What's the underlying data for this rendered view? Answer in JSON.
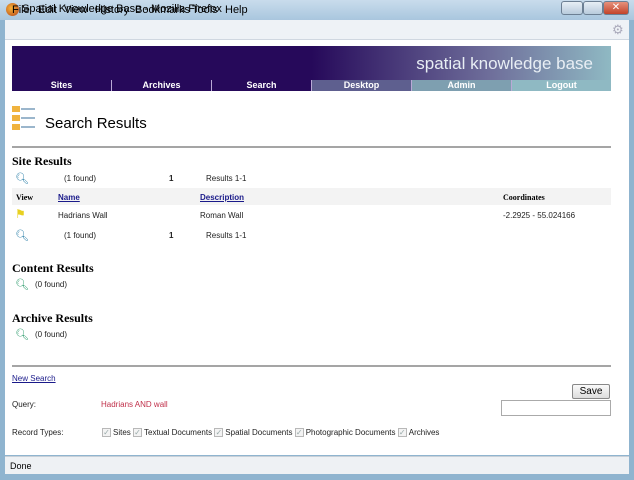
{
  "window": {
    "title": "Spatial Knowledge Base - Mozilla Firefox"
  },
  "menu": [
    "File",
    "Edit",
    "View",
    "History",
    "Bookmarks",
    "Tools",
    "Help"
  ],
  "banner": {
    "title": "spatial knowledge base"
  },
  "nav": [
    {
      "label": "Sites",
      "color": "#26095a"
    },
    {
      "label": "Archives",
      "color": "#26095a"
    },
    {
      "label": "Search",
      "color": "#26095a"
    },
    {
      "label": "Desktop",
      "color": "#5e5f8f"
    },
    {
      "label": "Admin",
      "color": "#7e9fb0"
    },
    {
      "label": "Logout",
      "color": "#8fb9c3"
    }
  ],
  "page_title": "Search Results",
  "site_results": {
    "heading": "Site Results",
    "found": "(1 found)",
    "page": "1",
    "range": "Results 1-1",
    "columns": {
      "view": "View",
      "name": "Name",
      "description": "Description",
      "coordinates": "Coordinates"
    },
    "rows": [
      {
        "name": "Hadrians Wall",
        "description": "Roman Wall",
        "coordinates": "-2.2925 - 55.024166"
      }
    ]
  },
  "content_results": {
    "heading": "Content Results",
    "found": "(0 found)"
  },
  "archive_results": {
    "heading": "Archive Results",
    "found": "(0 found)"
  },
  "new_search": "New Search",
  "save_label": "Save",
  "query": {
    "label": "Query:",
    "value": "Hadrians AND wall"
  },
  "record_types": {
    "label": "Record Types:",
    "items": [
      "Sites",
      "Textual Documents",
      "Spatial Documents",
      "Photographic Documents",
      "Archives"
    ]
  },
  "status": "Done"
}
